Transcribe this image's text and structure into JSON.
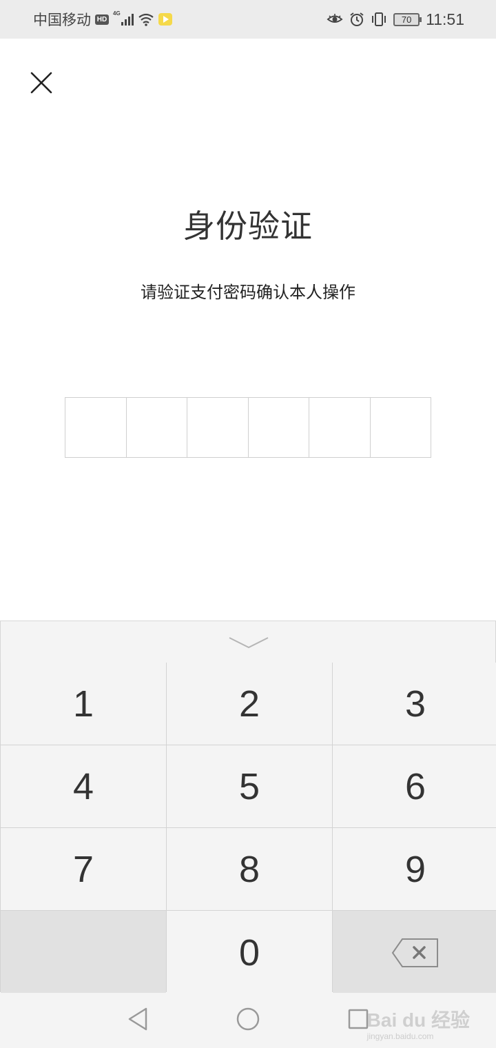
{
  "status_bar": {
    "carrier": "中国移动",
    "hd_badge": "HD",
    "network": "4G",
    "battery": "70",
    "time": "11:51"
  },
  "page": {
    "title": "身份验证",
    "subtitle": "请验证支付密码确认本人操作",
    "pin_length": 6
  },
  "keypad": {
    "keys": [
      "1",
      "2",
      "3",
      "4",
      "5",
      "6",
      "7",
      "8",
      "9",
      "",
      "0",
      "backspace"
    ]
  },
  "watermark": {
    "brand": "Bai du 经验",
    "url": "jingyan.baidu.com"
  },
  "icons": {
    "close": "close-icon",
    "collapse": "chevron-down-icon",
    "backspace": "backspace-icon",
    "nav_back": "back-triangle-icon",
    "nav_home": "home-circle-icon",
    "nav_recent": "recent-square-icon"
  }
}
